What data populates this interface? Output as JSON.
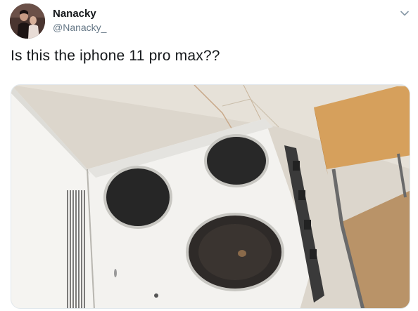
{
  "tweet": {
    "display_name": "Nanacky",
    "handle": "@Nanacky_",
    "text": "Is this the iphone 11 pro max??",
    "menu_icon": "chevron-down-icon",
    "avatar_icon": "avatar",
    "media_description": "photo-stove"
  },
  "colors": {
    "text_primary": "#14171a",
    "text_secondary": "#657786",
    "border": "#e1e8ed"
  }
}
